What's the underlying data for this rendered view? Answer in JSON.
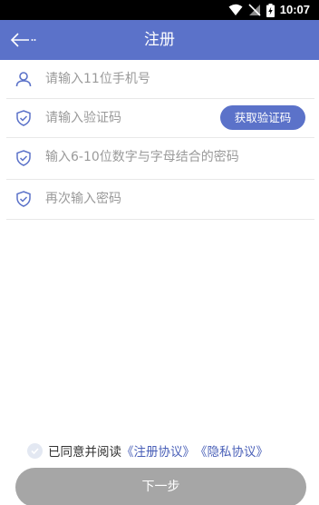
{
  "status_bar": {
    "time": "10:07",
    "icons": [
      "wifi-icon",
      "no-sim-icon",
      "battery-charging-icon"
    ]
  },
  "app_bar": {
    "title": "注册",
    "back_icon": "arrow-left-icon",
    "background": "#5b72c9"
  },
  "form": {
    "phone": {
      "icon": "user-icon",
      "placeholder": "请输入11位手机号",
      "value": ""
    },
    "code": {
      "icon": "shield-check-icon",
      "placeholder": "请输入验证码",
      "value": "",
      "button_label": "获取验证码"
    },
    "password": {
      "icon": "shield-check-icon",
      "placeholder": "输入6-10位数字与字母结合的密码",
      "value": ""
    },
    "confirm_password": {
      "icon": "shield-check-icon",
      "placeholder": "再次输入密码",
      "value": ""
    }
  },
  "agreement": {
    "checked": false,
    "prefix": "已同意并阅读",
    "register_link": "《注册协议》",
    "privacy_link": "《隐私协议》"
  },
  "next_button": {
    "label": "下一步",
    "color": "#a6a6a6"
  },
  "colors": {
    "accent": "#5b72c9",
    "link": "#4a60b8",
    "disabled": "#a6a6a6"
  }
}
